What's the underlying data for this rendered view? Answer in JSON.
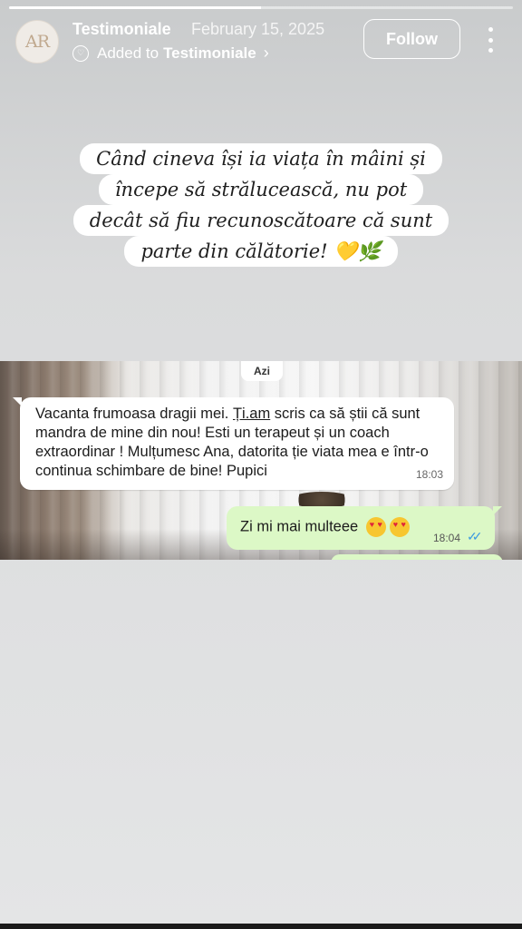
{
  "story": {
    "progress": 0.5,
    "colors": {
      "bubble_in": "#ffffff",
      "bubble_out": "#dcf8c6",
      "ticks": "#3b9ae1"
    }
  },
  "header": {
    "avatar_initials": "AR",
    "account_name": "Testimoniale",
    "date": "February 15, 2025",
    "added_prefix": "Added to",
    "added_target": "Testimoniale",
    "follow_label": "Follow",
    "icons": {
      "highlight": "highlight-icon",
      "chevron": "chevron-right-icon",
      "more": "more-vertical-icon"
    }
  },
  "quote": {
    "lines": [
      "Când cineva își ia viața în mâini și",
      "începe să strălucească, nu pot",
      "decât să fiu recunoscătoare că sunt",
      "parte din călătorie! 💛🌿"
    ]
  },
  "chat": {
    "day_label": "Azi",
    "incoming": {
      "part1": "Vacanta frumoasa dragii mei. ",
      "link": "Ți.am",
      "part2": " scris ca să știi că sunt mandra de mine din nou! Esti un terapeut și un coach  extraordinar ! Mulțumesc Ana, datorita ție viata mea e într-o continua schimbare de bine! Pupici",
      "time": "18:03"
    },
    "outgoing": {
      "text": "Zi mi mai multeee",
      "emoji": "heart-eyes-emoji",
      "time": "18:04",
      "ticks": "✓✓"
    }
  }
}
